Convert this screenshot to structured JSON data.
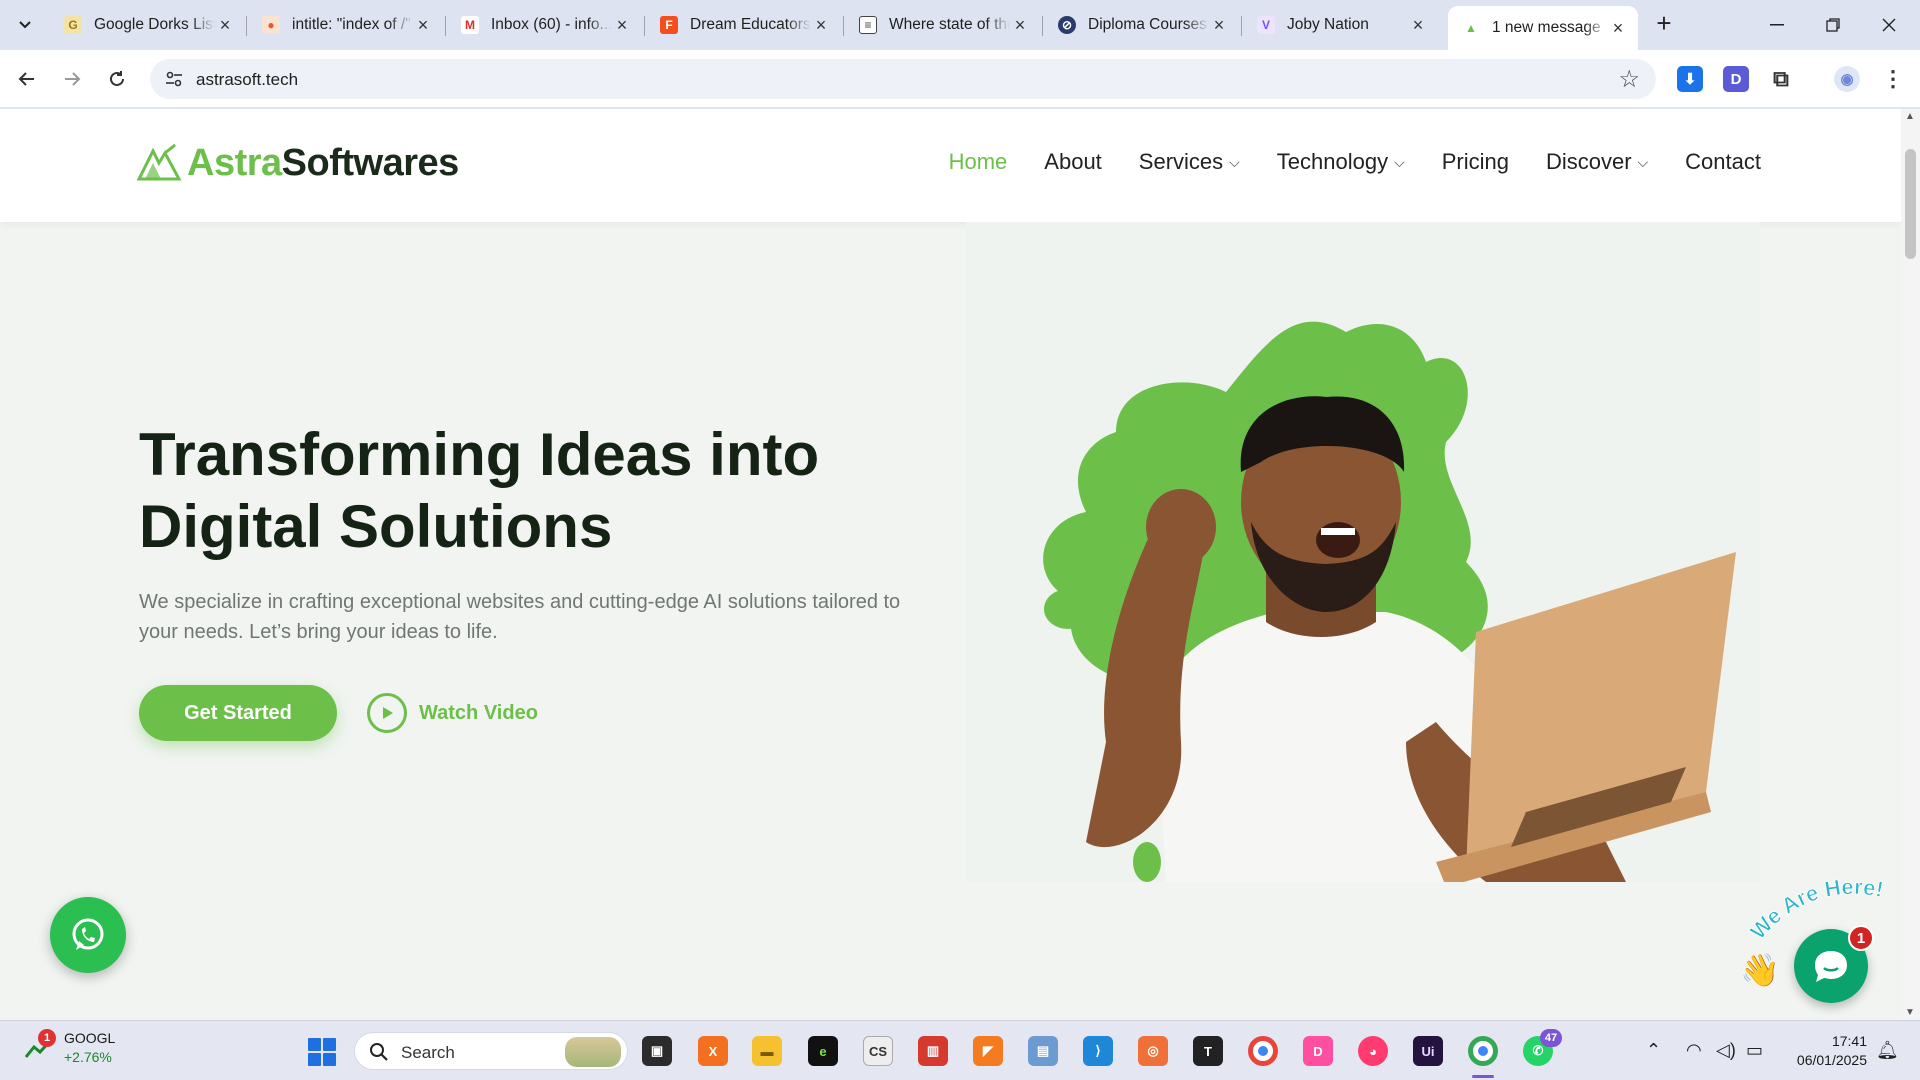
{
  "browser": {
    "tabs": [
      {
        "title": "Google Dorks List",
        "favicon_color": "#e0b030"
      },
      {
        "title": "intitle: \"index of /\"",
        "favicon_color": "#e45b24"
      },
      {
        "title": "Inbox (60) - info...",
        "favicon_color": "#d93025"
      },
      {
        "title": "Dream Educators",
        "favicon_color": "#a259ff"
      },
      {
        "title": "Where state of the",
        "favicon_color": "#444444"
      },
      {
        "title": "Diploma Courses",
        "favicon_color": "#2a3b6e"
      },
      {
        "title": "Joby Nation",
        "favicon_color": "#7c4dff"
      },
      {
        "title": "1 new message",
        "favicon_color": "#6cc04a",
        "active": true
      }
    ],
    "url": "astrasoft.tech"
  },
  "site": {
    "logo": {
      "part1": "Astra",
      "part2": "Softwares"
    },
    "nav": [
      {
        "label": "Home",
        "active": true,
        "dropdown": false
      },
      {
        "label": "About",
        "active": false,
        "dropdown": false
      },
      {
        "label": "Services",
        "active": false,
        "dropdown": true
      },
      {
        "label": "Technology",
        "active": false,
        "dropdown": true
      },
      {
        "label": "Pricing",
        "active": false,
        "dropdown": false
      },
      {
        "label": "Discover",
        "active": false,
        "dropdown": true
      },
      {
        "label": "Contact",
        "active": false,
        "dropdown": false
      }
    ],
    "hero": {
      "title": "Transforming Ideas into Digital Solutions",
      "subtitle": "We specialize in crafting exceptional websites and cutting-edge AI solutions tailored to your needs. Let’s bring your ideas to life.",
      "cta_primary": "Get Started",
      "cta_secondary": "Watch Video"
    },
    "chat_widget": {
      "banner": "We Are Here!",
      "unread": "1"
    },
    "colors": {
      "brand": "#6cc04a",
      "heading": "#152315"
    }
  },
  "taskbar": {
    "widget": {
      "symbol": "GOOGL",
      "change": "+2.76%",
      "badge": "1"
    },
    "search_placeholder": "Search",
    "whatsapp_badge": "47",
    "time": "17:41",
    "date": "06/01/2025"
  }
}
